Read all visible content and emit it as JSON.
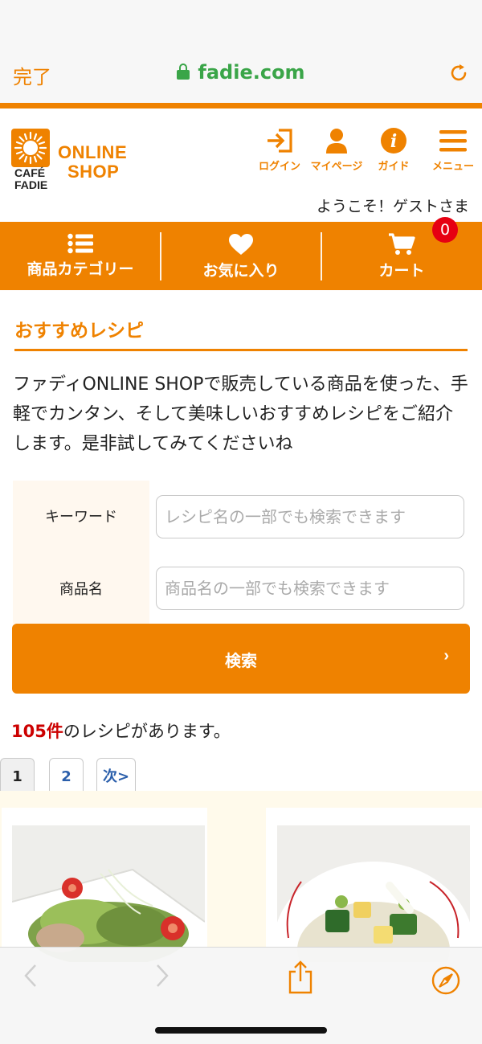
{
  "browser": {
    "done_label": "完了",
    "url": "fadie.com"
  },
  "header": {
    "logo_cafe_line1": "CAFÉ",
    "logo_cafe_line2": "FADIE",
    "logo_online": "ONLINE",
    "logo_shop": "SHOP",
    "nav": {
      "login": "ログイン",
      "mypage": "マイページ",
      "guide": "ガイド",
      "menu": "メニュー"
    },
    "welcome": "ようこそ！ゲストさま"
  },
  "category_bar": {
    "categories": "商品カテゴリー",
    "favorites": "お気に入り",
    "cart": "カート",
    "cart_count": "0"
  },
  "section": {
    "title": "おすすめレシピ",
    "intro": "ファディONLINE SHOPで販売している商品を使った、手軽でカンタン、そして美味しいおすすめレシピをご紹介します。是非試してみてくださいね"
  },
  "search_form": {
    "keyword_label": "キーワード",
    "keyword_placeholder": "レシピ名の一部でも検索できます",
    "keyword_value": "",
    "product_label": "商品名",
    "product_placeholder": "商品名の一部でも検索できます",
    "product_value": "",
    "submit_label": "検索",
    "submit_chevron": "›"
  },
  "results": {
    "count": "105件",
    "count_suffix": "のレシピがあります。"
  },
  "pagination": {
    "page1": "1",
    "page2": "2",
    "next": "次>"
  },
  "colors": {
    "accent": "#ef8200",
    "url_green": "#3aa548",
    "badge_red": "#e60012",
    "count_red": "#cc0000",
    "link_blue": "#2b5fab"
  },
  "icons": [
    "lock-icon",
    "reload-icon",
    "login-icon",
    "user-icon",
    "info-icon",
    "hamburger-icon",
    "list-icon",
    "heart-icon",
    "cart-icon",
    "back-icon",
    "forward-icon",
    "share-icon",
    "compass-icon"
  ]
}
